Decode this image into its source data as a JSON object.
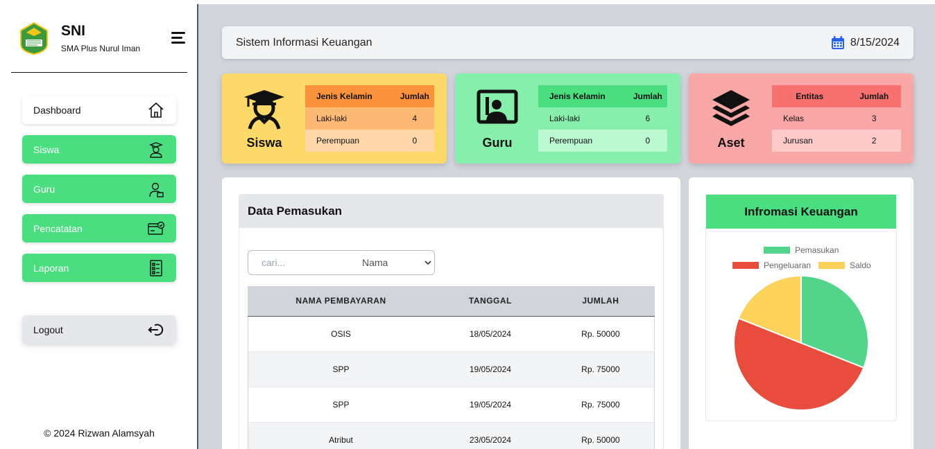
{
  "brand": {
    "title": "SNI",
    "subtitle": "SMA Plus Nurul Iman"
  },
  "sidebar": {
    "items": [
      {
        "label": "Dashboard",
        "icon": "home-icon"
      },
      {
        "label": "Siswa",
        "icon": "student-icon"
      },
      {
        "label": "Guru",
        "icon": "teacher-icon"
      },
      {
        "label": "Pencatatan",
        "icon": "wallet-check-icon"
      },
      {
        "label": "Laporan",
        "icon": "report-icon"
      }
    ],
    "logout": "Logout",
    "copyright": "© 2024 Rizwan Alamsyah"
  },
  "header": {
    "title": "Sistem Informasi Keuangan",
    "date": "8/15/2024"
  },
  "cards": {
    "siswa": {
      "label": "Siswa",
      "col1": "Jenis Kelamin",
      "col2": "Jumlah",
      "rows": [
        {
          "name": "Laki-laki",
          "value": "4"
        },
        {
          "name": "Perempuan",
          "value": "0"
        }
      ]
    },
    "guru": {
      "label": "Guru",
      "col1": "Jenis Kelamin",
      "col2": "Jumlah",
      "rows": [
        {
          "name": "Laki-laki",
          "value": "6"
        },
        {
          "name": "Perempuan",
          "value": "0"
        }
      ]
    },
    "aset": {
      "label": "Aset",
      "col1": "Entitas",
      "col2": "Jumlah",
      "rows": [
        {
          "name": "Kelas",
          "value": "3"
        },
        {
          "name": "Jurusan",
          "value": "2"
        }
      ]
    }
  },
  "pemasukan": {
    "title": "Data Pemasukan",
    "search_placeholder": "cari...",
    "filter_selected": "Nama",
    "columns": [
      "NAMA PEMBAYARAN",
      "TANGGAL",
      "JUMLAH"
    ],
    "rows": [
      [
        "OSIS",
        "18/05/2024",
        "Rp. 50000"
      ],
      [
        "SPP",
        "19/05/2024",
        "Rp. 75000"
      ],
      [
        "SPP",
        "19/05/2024",
        "Rp. 75000"
      ],
      [
        "Atribut",
        "23/05/2024",
        "Rp. 50000"
      ]
    ]
  },
  "chart_data": {
    "type": "pie",
    "title": "Infromasi Keuangan",
    "legend_position": "top",
    "series": [
      {
        "name": "Pemasukan",
        "value": 31,
        "color": "#52d48a"
      },
      {
        "name": "Pengeluaran",
        "value": 50,
        "color": "#e74c3c"
      },
      {
        "name": "Saldo",
        "value": 19,
        "color": "#fcd25a"
      }
    ]
  }
}
